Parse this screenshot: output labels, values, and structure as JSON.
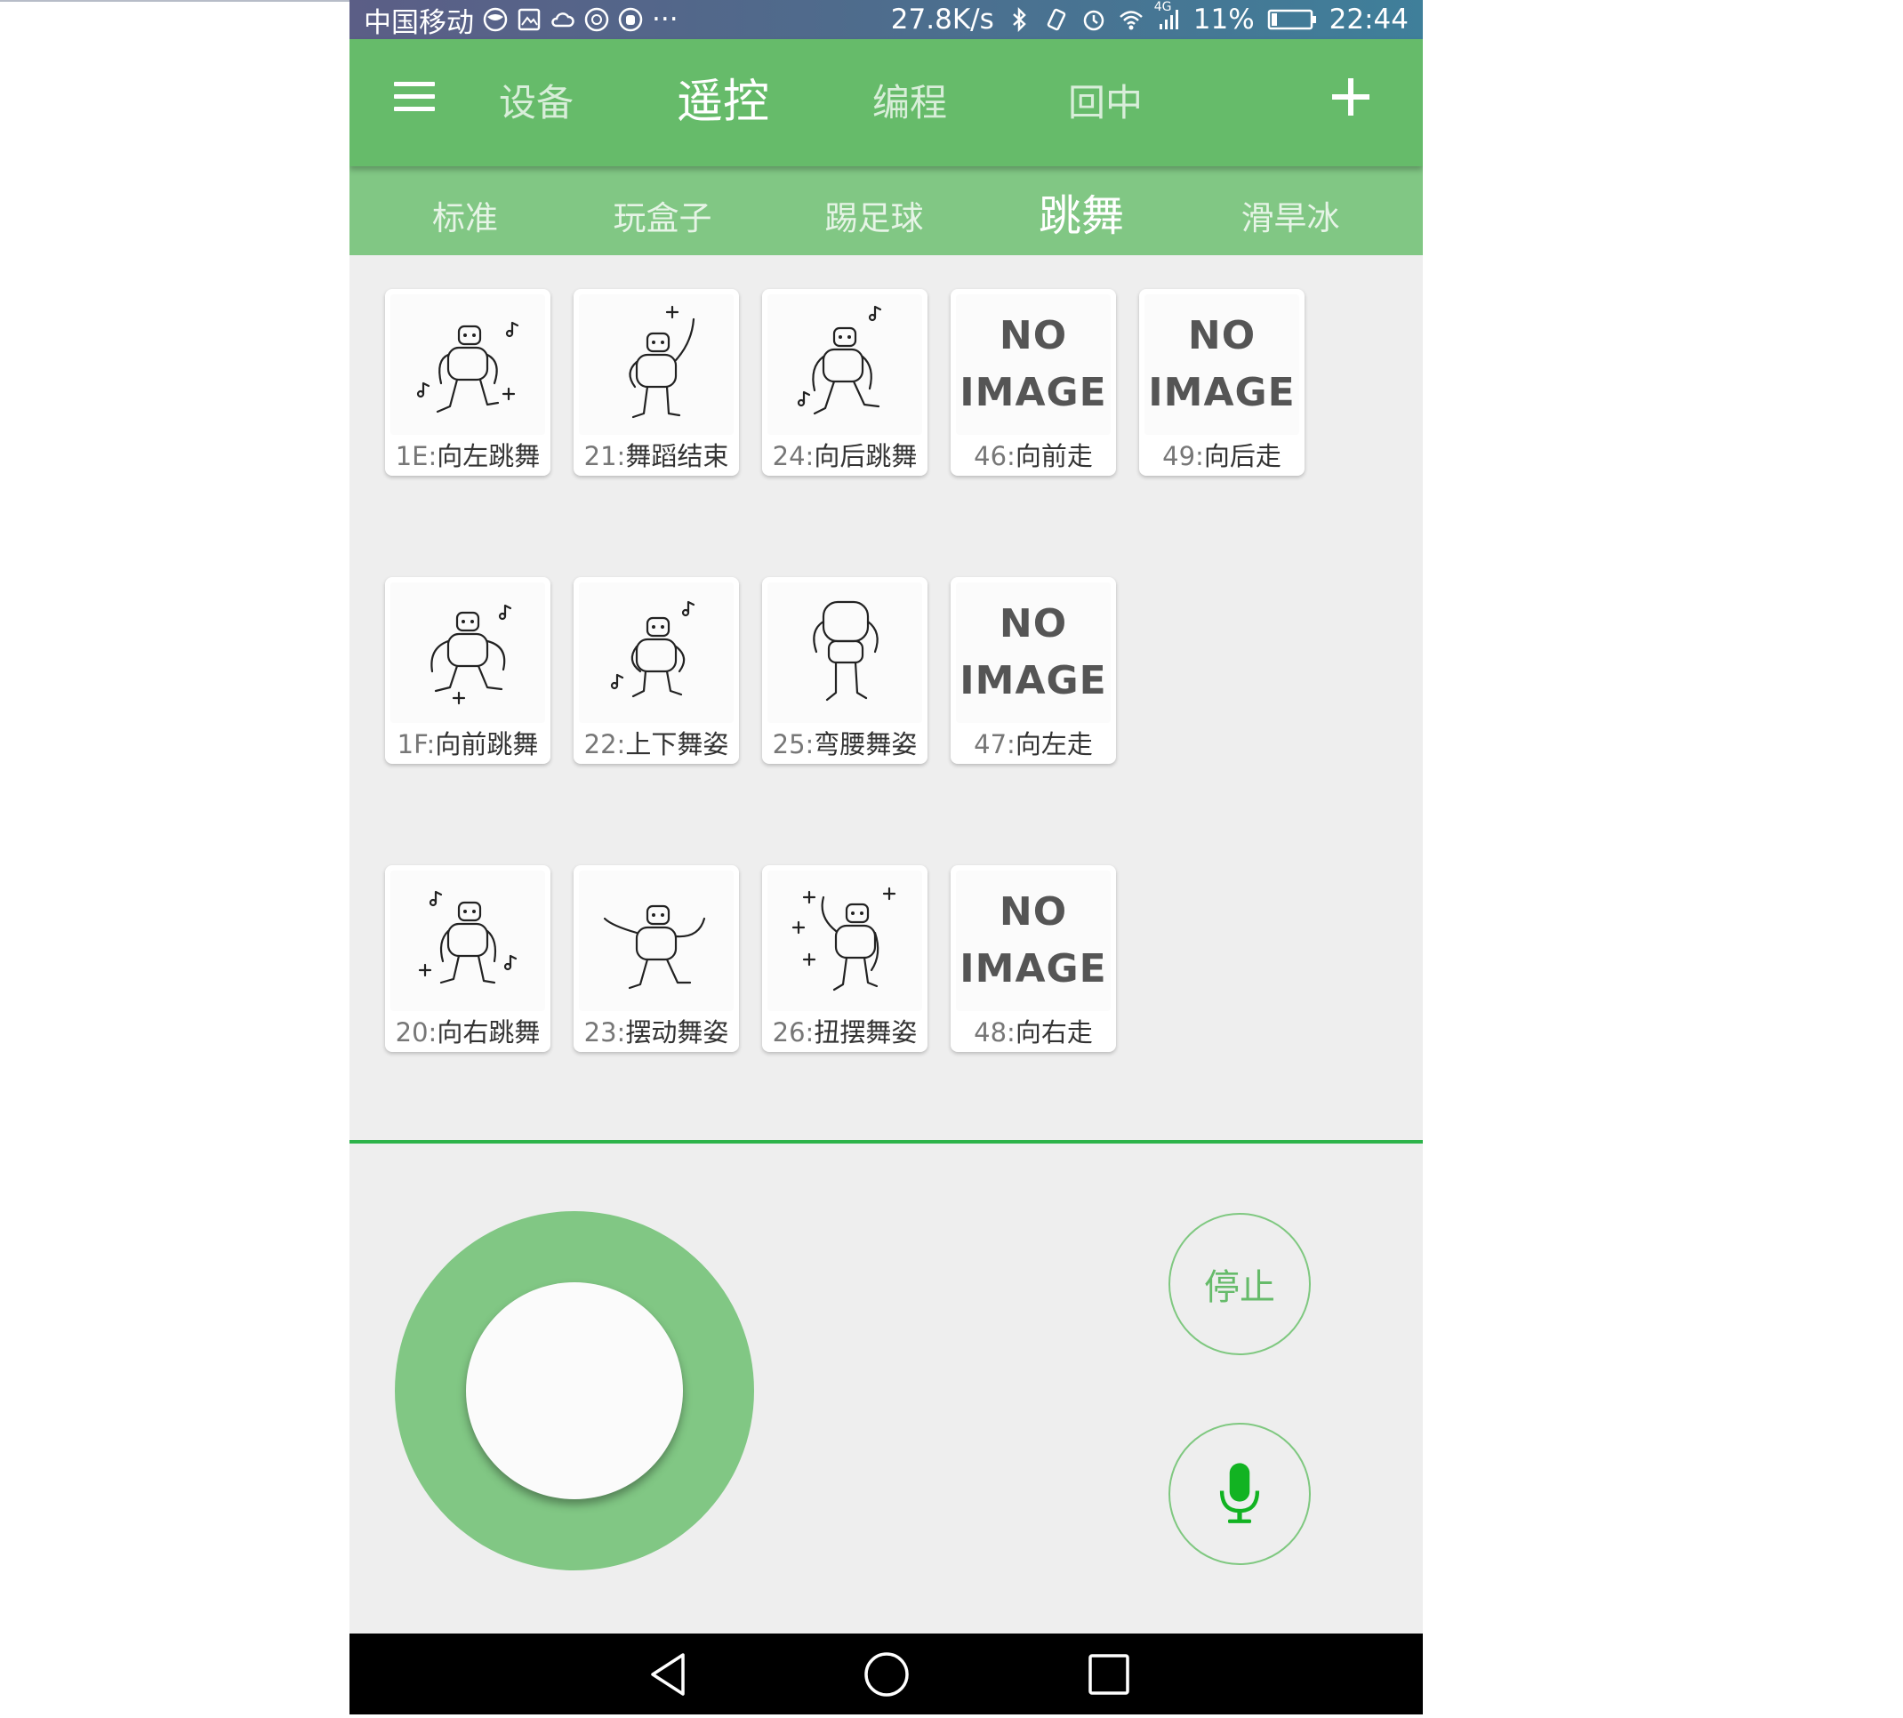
{
  "status_bar": {
    "carrier": "中国移动",
    "speed": "27.8K/s",
    "battery": "11%",
    "time": "22:44",
    "network_badge": "4G",
    "dots": "···"
  },
  "header": {
    "tabs": [
      "设备",
      "遥控",
      "编程",
      "回中"
    ],
    "active_tab": "遥控"
  },
  "subtabs": {
    "items": [
      "标准",
      "玩盒子",
      "踢足球",
      "跳舞",
      "滑旱冰"
    ],
    "active": "跳舞"
  },
  "actions": [
    {
      "code": "1E",
      "name": "向左跳舞",
      "image": "dance-left"
    },
    {
      "code": "21",
      "name": "舞蹈结束",
      "image": "dance-end"
    },
    {
      "code": "24",
      "name": "向后跳舞",
      "image": "dance-back"
    },
    {
      "code": "46",
      "name": "向前走",
      "image": "none"
    },
    {
      "code": "49",
      "name": "向后走",
      "image": "none"
    },
    {
      "code": "1F",
      "name": "向前跳舞",
      "image": "dance-forward"
    },
    {
      "code": "22",
      "name": "上下舞姿",
      "image": "dance-updown"
    },
    {
      "code": "25",
      "name": "弯腰舞姿",
      "image": "dance-bend"
    },
    {
      "code": "47",
      "name": "向左走",
      "image": "none"
    },
    {
      "code": "20",
      "name": "向右跳舞",
      "image": "dance-right"
    },
    {
      "code": "23",
      "name": "摆动舞姿",
      "image": "dance-swing"
    },
    {
      "code": "26",
      "name": "扭摆舞姿",
      "image": "dance-twist"
    },
    {
      "code": "48",
      "name": "向右走",
      "image": "none"
    }
  ],
  "no_image": {
    "line1": "NO",
    "line2": "IMAGE"
  },
  "controls": {
    "stop_label": "停止",
    "mic_color": "#12b322"
  },
  "colors": {
    "header": "#66bb6a",
    "subtabs": "#81c784",
    "joystick": "#81c784",
    "divider": "#2db34a"
  }
}
